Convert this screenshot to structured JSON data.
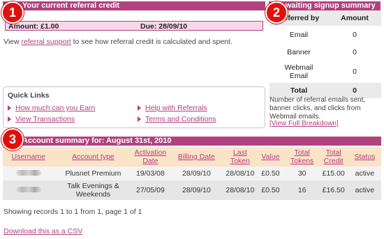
{
  "referral_credit": {
    "header": "Your current referral credit",
    "amount_label": "Amount:",
    "amount_value": "£1.00",
    "due_label": "Due:",
    "due_value": "28/09/10",
    "info_prefix": "View ",
    "info_link": "referral support",
    "info_suffix": " to see how referral credit is calculated and spent."
  },
  "signup_summary": {
    "header": "Awaiting signup summary",
    "columns": [
      "Referred by",
      "Amount"
    ],
    "rows": [
      {
        "label": "Email",
        "amount": "0"
      },
      {
        "label": "Banner",
        "amount": "0"
      },
      {
        "label": "Webmail Email",
        "amount": "0"
      }
    ],
    "total_label": "Total",
    "total_value": "0",
    "note": "Number of referral emails sent, banner clicks, and clicks from Webmail emails.",
    "breakdown_link": "[View Full Breakdown]"
  },
  "quick_links": {
    "title": "Quick Links",
    "links": [
      "How much can you Earn",
      "View Transactions",
      "Help with Referrals",
      "Terms and Conditions"
    ]
  },
  "account_summary": {
    "header": "Account summary for: August 31st, 2010",
    "columns": [
      "Username",
      "Account type",
      "Activation Date",
      "Billing Date",
      "Last Token",
      "Value",
      "Total Tokens",
      "Total Credit",
      "Status"
    ],
    "rows": [
      {
        "account_type": "Plusnet Premium",
        "activation": "19/03/08",
        "billing": "28/09/10",
        "last_token": "28/08/10",
        "value": "£0.50",
        "tokens": "30",
        "credit": "£15.00",
        "status": "active"
      },
      {
        "account_type": "Talk Evenings & Weekends",
        "activation": "27/05/09",
        "billing": "28/09/10",
        "last_token": "28/08/10",
        "value": "£0.50",
        "tokens": "16",
        "credit": "£16.50",
        "status": "active"
      }
    ],
    "records_text": "Showing records 1 to 1 from 1, page 1 of 1",
    "csv_link": "Download this as a CSV"
  },
  "badges": [
    "1",
    "2",
    "3"
  ],
  "colors": {
    "accent": "#b2417f",
    "badge": "#e01010",
    "table_header": "#fbe3c8",
    "credit_box": "#f7d8e8"
  }
}
